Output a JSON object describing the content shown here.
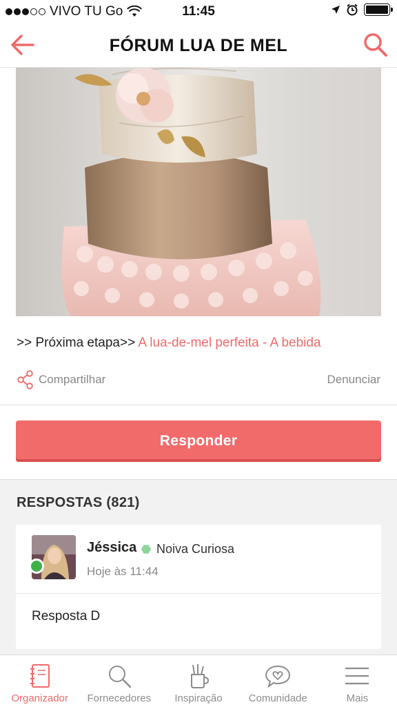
{
  "status_bar": {
    "carrier": "VIVO TU Go",
    "time": "11:45"
  },
  "nav": {
    "title": "FÓRUM LUA DE MEL",
    "back_icon": "back-arrow-icon",
    "search_icon": "search-icon"
  },
  "post": {
    "next_prefix": ">> Próxima etapa>> ",
    "next_link": "A lua-de-mel perfeita - A bebida",
    "share_label": "Compartilhar",
    "report_label": "Denunciar"
  },
  "reply_button_label": "Responder",
  "answers": {
    "header": "RESPOSTAS (821)",
    "items": [
      {
        "user": "Jéssica",
        "badge": "Noiva Curiosa",
        "time": "Hoje às 11:44",
        "text": "Resposta D"
      }
    ]
  },
  "tabs": [
    {
      "label": "Organizador",
      "icon": "notebook-icon",
      "active": true
    },
    {
      "label": "Fornecedores",
      "icon": "search-icon",
      "active": false
    },
    {
      "label": "Inspiração",
      "icon": "pencil-cup-icon",
      "active": false
    },
    {
      "label": "Comunidade",
      "icon": "heart-chat-icon",
      "active": false
    },
    {
      "label": "Mais",
      "icon": "menu-icon",
      "active": false
    }
  ],
  "colors": {
    "accent": "#f06a6a",
    "online": "#3fb04a"
  }
}
